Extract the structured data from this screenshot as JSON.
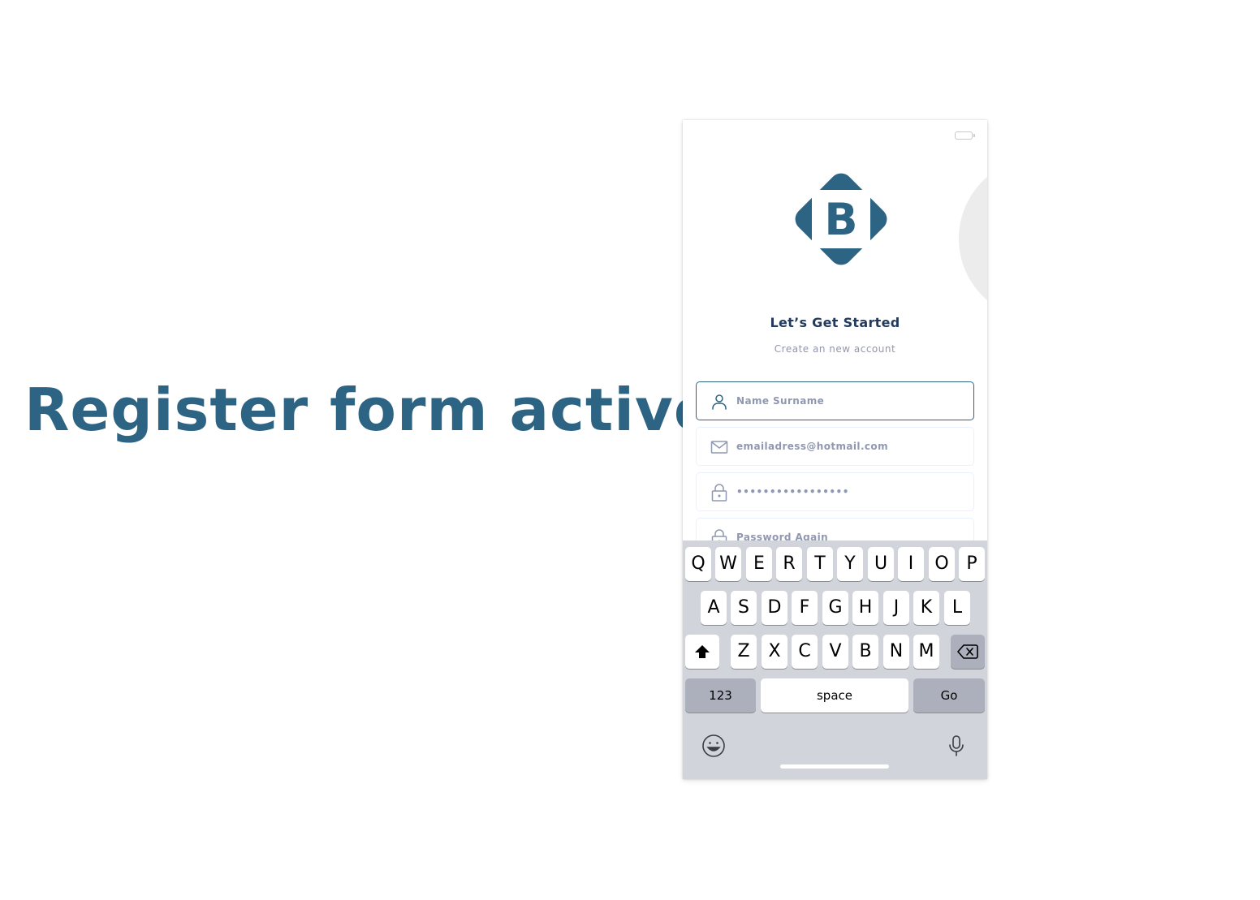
{
  "caption": "Register form active",
  "colors": {
    "brand": "#2e6483",
    "title": "#223a5e",
    "muted": "#9098b1",
    "field_border": "#ebf0ff",
    "keyboard_bg": "#d1d4da"
  },
  "app": {
    "logo_letter": "B",
    "title": "Let’s Get Started",
    "subtitle": "Create an new account"
  },
  "form": {
    "fields": [
      {
        "icon": "user-icon",
        "text": "Name Surname",
        "state": "active"
      },
      {
        "icon": "mail-icon",
        "text": "emailadress@hotmail.com"
      },
      {
        "icon": "lock-icon",
        "text": "•••••••••••••••••"
      },
      {
        "icon": "lock-icon",
        "text": "Password Again"
      }
    ]
  },
  "keyboard": {
    "row1": [
      "Q",
      "W",
      "E",
      "R",
      "T",
      "Y",
      "U",
      "I",
      "O",
      "P"
    ],
    "row2": [
      "A",
      "S",
      "D",
      "F",
      "G",
      "H",
      "J",
      "K",
      "L"
    ],
    "row3": [
      "Z",
      "X",
      "C",
      "V",
      "B",
      "N",
      "M"
    ],
    "numbers_label": "123",
    "space_label": "space",
    "go_label": "Go",
    "icons": [
      "shift-icon",
      "backspace-icon",
      "emoji-icon",
      "microphone-icon"
    ]
  }
}
